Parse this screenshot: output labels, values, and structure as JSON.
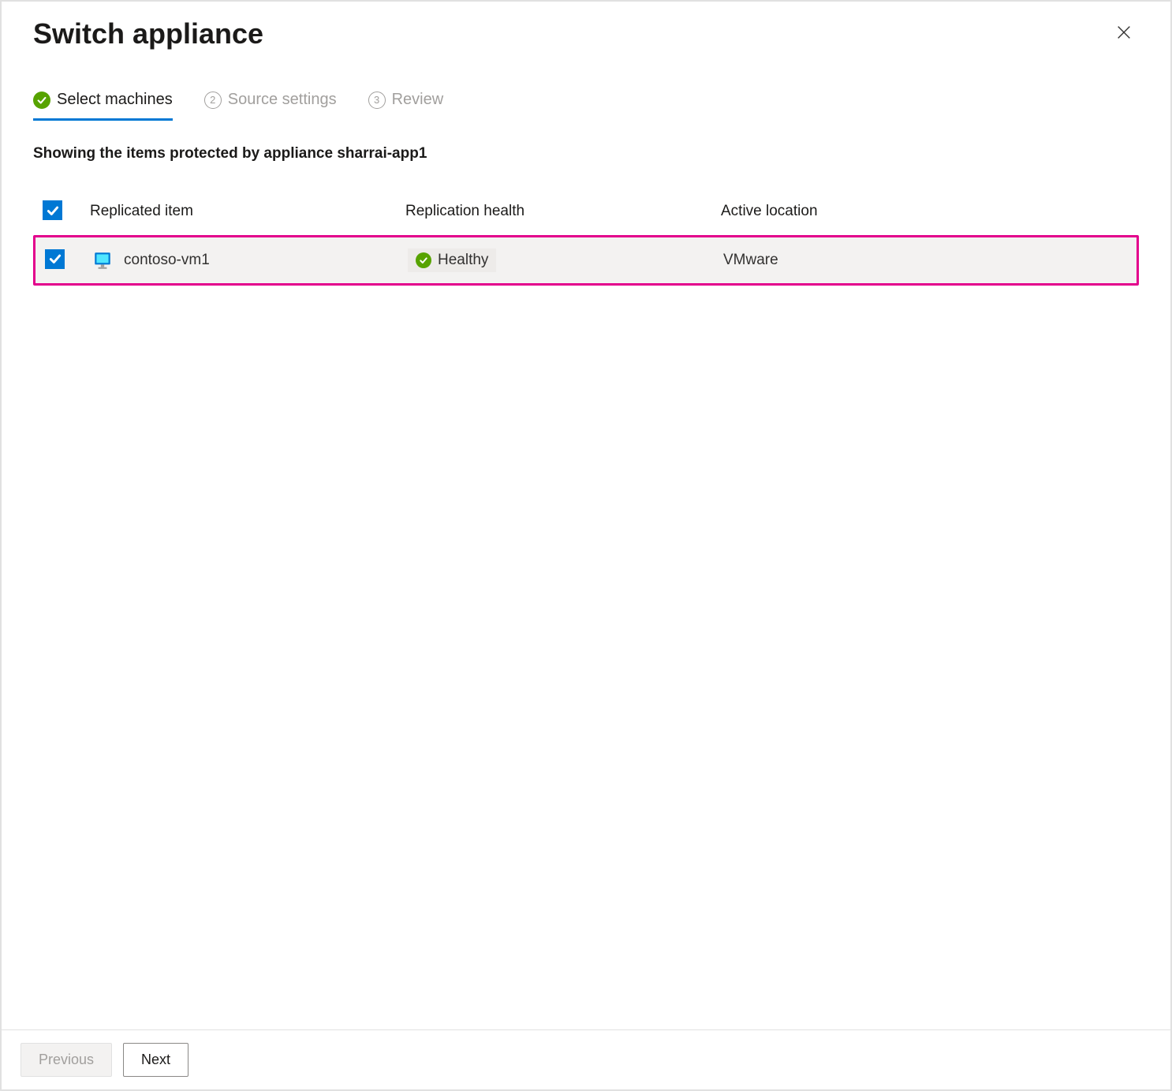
{
  "header": {
    "title": "Switch appliance"
  },
  "tabs": {
    "step1": {
      "label": "Select machines"
    },
    "step2": {
      "number": "2",
      "label": "Source settings"
    },
    "step3": {
      "number": "3",
      "label": "Review"
    }
  },
  "subtitle": "Showing the items protected by appliance sharrai-app1",
  "table": {
    "columns": {
      "item": "Replicated item",
      "health": "Replication health",
      "location": "Active location"
    },
    "rows": [
      {
        "name": "contoso-vm1",
        "health": "Healthy",
        "location": "VMware"
      }
    ]
  },
  "footer": {
    "previous": "Previous",
    "next": "Next"
  }
}
